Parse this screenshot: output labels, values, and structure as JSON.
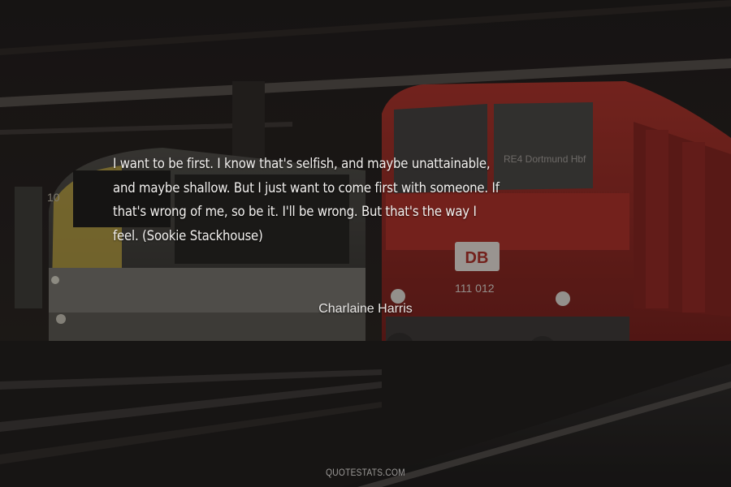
{
  "quote": {
    "lines": [
      "I want to be first. I know that's selfish, and maybe unattainable,",
      "and maybe shallow. But I just want to come first with someone. If",
      "that's wrong of me, so be it. I'll be wrong. But that's the way I",
      "feel. (Sookie Stackhouse)"
    ]
  },
  "author": "Charlaine Harris",
  "brand": "QUOTESTATS.COM",
  "train_signs": {
    "destination": "RE4 Dortmund Hbf",
    "logo": "DB",
    "number": "111 012",
    "other_number": "10"
  },
  "colors": {
    "train_red": "#8e2622",
    "text": "#f2f0ee"
  }
}
